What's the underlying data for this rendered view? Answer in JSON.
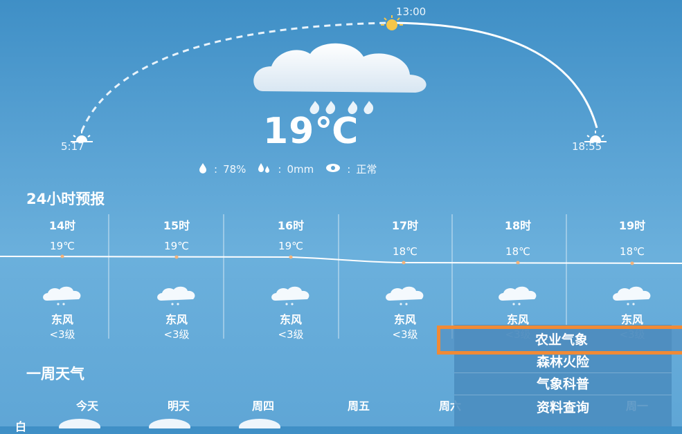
{
  "sun": {
    "noon_time": "13:00",
    "sunrise": "5:17",
    "sunset": "18:55"
  },
  "current": {
    "temperature": "19℃",
    "humidity": "78%",
    "precipitation": "0mm",
    "visibility": "正常",
    "colon": ":"
  },
  "hourly": {
    "title": "24小时预报",
    "items": [
      {
        "hour": "14时",
        "temp": "19℃",
        "wind": "东风",
        "level": "<3级"
      },
      {
        "hour": "15时",
        "temp": "19℃",
        "wind": "东风",
        "level": "<3级"
      },
      {
        "hour": "16时",
        "temp": "19℃",
        "wind": "东风",
        "level": "<3级"
      },
      {
        "hour": "17时",
        "temp": "18℃",
        "wind": "东风",
        "level": "<3级"
      },
      {
        "hour": "18时",
        "temp": "18℃",
        "wind": "东风",
        "level": "<3级"
      },
      {
        "hour": "19时",
        "temp": "18℃",
        "wind": "东风",
        "level": "<3级"
      }
    ]
  },
  "weekly": {
    "title": "一周天气",
    "days": [
      "今天",
      "明天",
      "周四",
      "周五",
      "周六",
      "周一"
    ],
    "row_label": "白"
  },
  "menu": {
    "items": [
      "农业气象",
      "森林火险",
      "气象科普",
      "资料查询"
    ]
  },
  "colors": {
    "highlight": "#f08a36",
    "sun": "#f6c64a"
  }
}
